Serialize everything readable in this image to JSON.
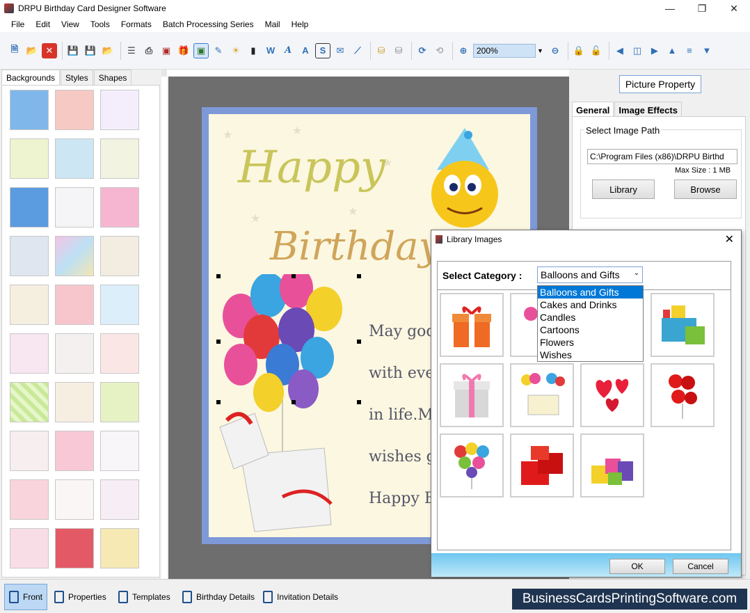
{
  "window": {
    "title": "DRPU Birthday Card Designer Software"
  },
  "menu": [
    "File",
    "Edit",
    "View",
    "Tools",
    "Formats",
    "Batch Processing Series",
    "Mail",
    "Help"
  ],
  "toolbar": {
    "zoom_value": "200%",
    "icons": [
      "new-file-icon",
      "open-folder-icon",
      "close-icon",
      "save-icon",
      "save-as-icon",
      "export-icon",
      "properties-icon",
      "print-icon",
      "print-preview-icon",
      "gift-icon",
      "insert-picture-icon",
      "pencil-icon",
      "image-icon",
      "barcode-icon",
      "word-art-icon",
      "text-icon",
      "text-box-icon",
      "signature-icon",
      "mail-icon",
      "line-icon",
      "database-icon",
      "database-alt-icon",
      "undo-icon",
      "redo-icon",
      "zoom-in-icon",
      "zoom-out-icon",
      "lock-icon",
      "unlock-icon",
      "arrow-left-icon",
      "flip-icon",
      "arrow-right-icon",
      "arrow-up-icon",
      "align-icon",
      "arrow-down-icon"
    ]
  },
  "left_panel": {
    "tabs": [
      "Backgrounds",
      "Styles",
      "Shapes"
    ],
    "active_tab": "Backgrounds"
  },
  "card": {
    "happy": "Happy",
    "birthday": "Birthday",
    "lines": [
      "May god",
      "with ever",
      "in life.Ma",
      "wishes g",
      "Happy Bi"
    ]
  },
  "right_panel": {
    "title": "Picture Property",
    "tabs": [
      "General",
      "Image Effects"
    ],
    "active_tab": "General",
    "group_label": "Select Image Path",
    "image_path": "C:\\Program Files (x86)\\DRPU Birthd",
    "max_size": "Max Size : 1 MB",
    "library_button": "Library",
    "browse_button": "Browse"
  },
  "dialog": {
    "title": "Library Images",
    "category_label": "Select Category :",
    "selected_category": "Balloons and Gifts",
    "categories": [
      "Balloons and Gifts",
      "Cakes and Drinks",
      "Candles",
      "Cartoons",
      "Flowers",
      "Wishes"
    ],
    "ok_button": "OK",
    "cancel_button": "Cancel"
  },
  "bottom_tabs": [
    "Front",
    "Properties",
    "Templates",
    "Birthday Details",
    "Invitation Details"
  ],
  "active_bottom_tab": "Front",
  "brand": "BusinessCardsPrintingSoftware.com"
}
